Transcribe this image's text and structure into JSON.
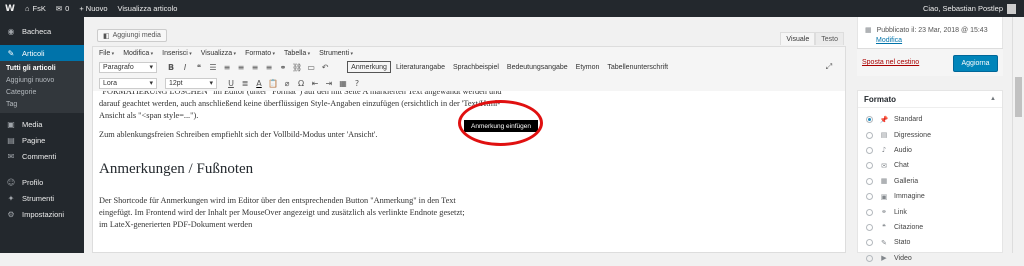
{
  "adminbar": {
    "logo_glyph": "W",
    "site_icon": "⌂",
    "site_name": "FsK",
    "comments_icon": "✉",
    "comments_count": "0",
    "new_label": "+ Nuovo",
    "view_label": "Visualizza articolo",
    "greeting": "Ciao, Sebastian Postlep"
  },
  "sidebar": {
    "items": [
      {
        "icon": "◉",
        "label": "Bacheca"
      },
      {
        "icon": "✎",
        "label": "Articoli"
      },
      {
        "icon": "▣",
        "label": "Media"
      },
      {
        "icon": "▤",
        "label": "Pagine"
      },
      {
        "icon": "✉",
        "label": "Commenti"
      },
      {
        "icon": "☺",
        "label": "Profilo"
      },
      {
        "icon": "✦",
        "label": "Strumenti"
      },
      {
        "icon": "⚙",
        "label": "Impostazioni"
      }
    ],
    "submenu": [
      "Tutti gli articoli",
      "Aggiungi nuovo",
      "Categorie",
      "Tag"
    ]
  },
  "editor": {
    "add_media": "Aggiungi media",
    "add_media_icon": "◧",
    "tab_visual": "Visuale",
    "tab_text": "Testo",
    "menubar": [
      "File",
      "Modifica",
      "Inserisci",
      "Visualizza",
      "Formato",
      "Tabella",
      "Strumenti"
    ],
    "paragraph_select": "Paragrafo",
    "font_select": "Lora",
    "size_select": "12pt",
    "custom_buttons": [
      "Anmerkung",
      "Literaturangabe",
      "Sprachbeispiel",
      "Bedeutungsangabe",
      "Etymon",
      "Tabellenunterschrift"
    ],
    "tooltip": "Anmerkung einfügen",
    "icons": {
      "bold": "B",
      "italic": "I",
      "quote": "❝",
      "ul": "☰",
      "ol": "≡",
      "align_left": "≡",
      "align_center": "≡",
      "align_right": "≡",
      "link": "⚭",
      "unlink": "⛓",
      "more": "▭",
      "undo": "↶",
      "fullscreen": "⤢",
      "underline": "U",
      "justify": "≣",
      "color": "A",
      "paste": "📋",
      "clear": "⌀",
      "omega": "Ω",
      "outdent": "⇤",
      "indent": "⇥",
      "table": "▦",
      "help": "?"
    }
  },
  "content": {
    "p1": "\"FORMATIERUNG LÖSCHEN\" im Editor (unter \"Format\") auf den mit Seite A markierten Text angewandt werden und darauf geachtet werden, auch anschließend keine überflüssigen Style-Angaben einzufügen (ersichtlich in der 'Text/Html-Ansicht als \"<span style=...\").",
    "p2": "Zum ablenkungsfreien Schreiben empfiehlt sich der Vollbild-Modus unter 'Ansicht'.",
    "h2": "Anmerkungen / Fußnoten",
    "p3": "Der Shortcode für Anmerkungen wird im Editor über den entsprechenden Button \"Anmerkung\" in den Text eingefügt. Im Frontend wird der Inhalt per MouseOver angezeigt und zusätzlich als verlinkte Endnote gesetzt; im LateX-generierten PDF-Dokument werden"
  },
  "publish": {
    "calendar_icon": "▦",
    "published": "Pubblicato il: 23 Mar, 2018 @ 15:43",
    "modify": "Modifica",
    "trash": "Sposta nel cestino",
    "update": "Aggiorna"
  },
  "format": {
    "title": "Formato",
    "toggle": "▲",
    "options": [
      {
        "icon": "📌",
        "label": "Standard",
        "checked": true
      },
      {
        "icon": "▤",
        "label": "Digressione",
        "checked": false
      },
      {
        "icon": "♪",
        "label": "Audio",
        "checked": false
      },
      {
        "icon": "✉",
        "label": "Chat",
        "checked": false
      },
      {
        "icon": "▦",
        "label": "Galleria",
        "checked": false
      },
      {
        "icon": "▣",
        "label": "Immagine",
        "checked": false
      },
      {
        "icon": "⚭",
        "label": "Link",
        "checked": false
      },
      {
        "icon": "❝",
        "label": "Citazione",
        "checked": false
      },
      {
        "icon": "✎",
        "label": "Stato",
        "checked": false
      },
      {
        "icon": "▶",
        "label": "Video",
        "checked": false
      }
    ]
  }
}
